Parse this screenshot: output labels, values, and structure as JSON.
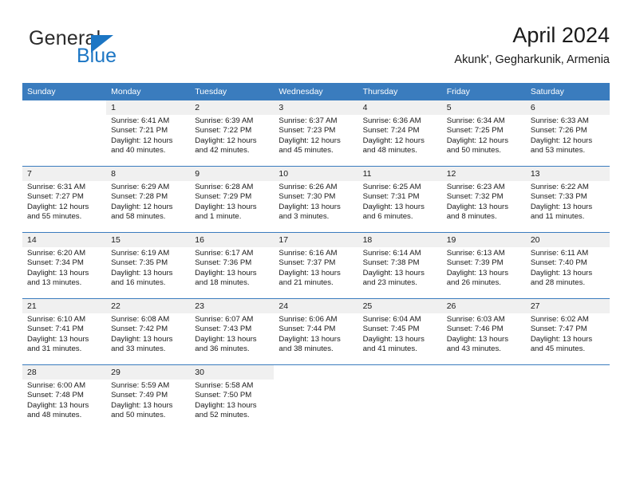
{
  "brand": {
    "word1": "General",
    "word2": "Blue",
    "accent_color": "#1c76c4"
  },
  "header": {
    "title": "April 2024",
    "subtitle": "Akunk', Gegharkunik, Armenia"
  },
  "calendar": {
    "header_bg": "#3a7cbe",
    "daynum_bg": "#f0f0f0",
    "weekday_headers": [
      "Sunday",
      "Monday",
      "Tuesday",
      "Wednesday",
      "Thursday",
      "Friday",
      "Saturday"
    ],
    "weeks": [
      [
        {
          "day": "",
          "lines": []
        },
        {
          "day": "1",
          "lines": [
            "Sunrise: 6:41 AM",
            "Sunset: 7:21 PM",
            "Daylight: 12 hours",
            "and 40 minutes."
          ]
        },
        {
          "day": "2",
          "lines": [
            "Sunrise: 6:39 AM",
            "Sunset: 7:22 PM",
            "Daylight: 12 hours",
            "and 42 minutes."
          ]
        },
        {
          "day": "3",
          "lines": [
            "Sunrise: 6:37 AM",
            "Sunset: 7:23 PM",
            "Daylight: 12 hours",
            "and 45 minutes."
          ]
        },
        {
          "day": "4",
          "lines": [
            "Sunrise: 6:36 AM",
            "Sunset: 7:24 PM",
            "Daylight: 12 hours",
            "and 48 minutes."
          ]
        },
        {
          "day": "5",
          "lines": [
            "Sunrise: 6:34 AM",
            "Sunset: 7:25 PM",
            "Daylight: 12 hours",
            "and 50 minutes."
          ]
        },
        {
          "day": "6",
          "lines": [
            "Sunrise: 6:33 AM",
            "Sunset: 7:26 PM",
            "Daylight: 12 hours",
            "and 53 minutes."
          ]
        }
      ],
      [
        {
          "day": "7",
          "lines": [
            "Sunrise: 6:31 AM",
            "Sunset: 7:27 PM",
            "Daylight: 12 hours",
            "and 55 minutes."
          ]
        },
        {
          "day": "8",
          "lines": [
            "Sunrise: 6:29 AM",
            "Sunset: 7:28 PM",
            "Daylight: 12 hours",
            "and 58 minutes."
          ]
        },
        {
          "day": "9",
          "lines": [
            "Sunrise: 6:28 AM",
            "Sunset: 7:29 PM",
            "Daylight: 13 hours",
            "and 1 minute."
          ]
        },
        {
          "day": "10",
          "lines": [
            "Sunrise: 6:26 AM",
            "Sunset: 7:30 PM",
            "Daylight: 13 hours",
            "and 3 minutes."
          ]
        },
        {
          "day": "11",
          "lines": [
            "Sunrise: 6:25 AM",
            "Sunset: 7:31 PM",
            "Daylight: 13 hours",
            "and 6 minutes."
          ]
        },
        {
          "day": "12",
          "lines": [
            "Sunrise: 6:23 AM",
            "Sunset: 7:32 PM",
            "Daylight: 13 hours",
            "and 8 minutes."
          ]
        },
        {
          "day": "13",
          "lines": [
            "Sunrise: 6:22 AM",
            "Sunset: 7:33 PM",
            "Daylight: 13 hours",
            "and 11 minutes."
          ]
        }
      ],
      [
        {
          "day": "14",
          "lines": [
            "Sunrise: 6:20 AM",
            "Sunset: 7:34 PM",
            "Daylight: 13 hours",
            "and 13 minutes."
          ]
        },
        {
          "day": "15",
          "lines": [
            "Sunrise: 6:19 AM",
            "Sunset: 7:35 PM",
            "Daylight: 13 hours",
            "and 16 minutes."
          ]
        },
        {
          "day": "16",
          "lines": [
            "Sunrise: 6:17 AM",
            "Sunset: 7:36 PM",
            "Daylight: 13 hours",
            "and 18 minutes."
          ]
        },
        {
          "day": "17",
          "lines": [
            "Sunrise: 6:16 AM",
            "Sunset: 7:37 PM",
            "Daylight: 13 hours",
            "and 21 minutes."
          ]
        },
        {
          "day": "18",
          "lines": [
            "Sunrise: 6:14 AM",
            "Sunset: 7:38 PM",
            "Daylight: 13 hours",
            "and 23 minutes."
          ]
        },
        {
          "day": "19",
          "lines": [
            "Sunrise: 6:13 AM",
            "Sunset: 7:39 PM",
            "Daylight: 13 hours",
            "and 26 minutes."
          ]
        },
        {
          "day": "20",
          "lines": [
            "Sunrise: 6:11 AM",
            "Sunset: 7:40 PM",
            "Daylight: 13 hours",
            "and 28 minutes."
          ]
        }
      ],
      [
        {
          "day": "21",
          "lines": [
            "Sunrise: 6:10 AM",
            "Sunset: 7:41 PM",
            "Daylight: 13 hours",
            "and 31 minutes."
          ]
        },
        {
          "day": "22",
          "lines": [
            "Sunrise: 6:08 AM",
            "Sunset: 7:42 PM",
            "Daylight: 13 hours",
            "and 33 minutes."
          ]
        },
        {
          "day": "23",
          "lines": [
            "Sunrise: 6:07 AM",
            "Sunset: 7:43 PM",
            "Daylight: 13 hours",
            "and 36 minutes."
          ]
        },
        {
          "day": "24",
          "lines": [
            "Sunrise: 6:06 AM",
            "Sunset: 7:44 PM",
            "Daylight: 13 hours",
            "and 38 minutes."
          ]
        },
        {
          "day": "25",
          "lines": [
            "Sunrise: 6:04 AM",
            "Sunset: 7:45 PM",
            "Daylight: 13 hours",
            "and 41 minutes."
          ]
        },
        {
          "day": "26",
          "lines": [
            "Sunrise: 6:03 AM",
            "Sunset: 7:46 PM",
            "Daylight: 13 hours",
            "and 43 minutes."
          ]
        },
        {
          "day": "27",
          "lines": [
            "Sunrise: 6:02 AM",
            "Sunset: 7:47 PM",
            "Daylight: 13 hours",
            "and 45 minutes."
          ]
        }
      ],
      [
        {
          "day": "28",
          "lines": [
            "Sunrise: 6:00 AM",
            "Sunset: 7:48 PM",
            "Daylight: 13 hours",
            "and 48 minutes."
          ]
        },
        {
          "day": "29",
          "lines": [
            "Sunrise: 5:59 AM",
            "Sunset: 7:49 PM",
            "Daylight: 13 hours",
            "and 50 minutes."
          ]
        },
        {
          "day": "30",
          "lines": [
            "Sunrise: 5:58 AM",
            "Sunset: 7:50 PM",
            "Daylight: 13 hours",
            "and 52 minutes."
          ]
        },
        {
          "day": "",
          "lines": []
        },
        {
          "day": "",
          "lines": []
        },
        {
          "day": "",
          "lines": []
        },
        {
          "day": "",
          "lines": []
        }
      ]
    ]
  }
}
